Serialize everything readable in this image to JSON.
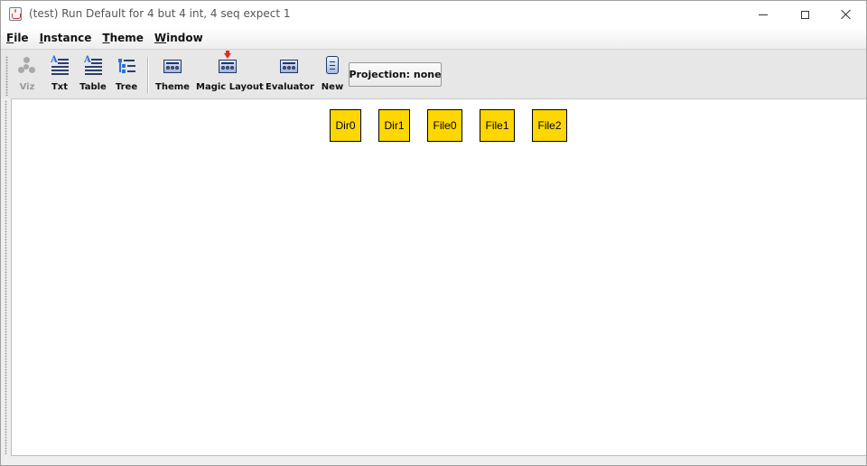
{
  "window": {
    "title": "(test) Run Default for 4 but 4 int, 4 seq expect 1"
  },
  "menu": [
    {
      "key": "F",
      "rest": "ile"
    },
    {
      "key": "I",
      "rest": "nstance"
    },
    {
      "key": "T",
      "rest": "heme"
    },
    {
      "key": "W",
      "rest": "indow"
    }
  ],
  "toolbar": {
    "viz": {
      "label": "Viz",
      "icon": "viz-graph-icon",
      "enabled": false
    },
    "txt": {
      "label": "Txt",
      "icon": "text-lines-icon"
    },
    "table": {
      "label": "Table",
      "icon": "table-lines-icon"
    },
    "tree": {
      "label": "Tree",
      "icon": "tree-list-icon"
    },
    "theme": {
      "label": "Theme",
      "icon": "theme-panel-icon"
    },
    "magic_layout": {
      "label": "Magic Layout",
      "icon": "magic-layout-icon"
    },
    "evaluator": {
      "label": "Evaluator",
      "icon": "evaluator-panel-icon"
    },
    "new": {
      "label": "New",
      "icon": "new-scroll-icon"
    },
    "projection": "Projection: none"
  },
  "graph": {
    "node_color": "#ffd700",
    "nodes": [
      {
        "label": "Dir0"
      },
      {
        "label": "Dir1"
      },
      {
        "label": "File0"
      },
      {
        "label": "File1"
      },
      {
        "label": "File2"
      }
    ]
  }
}
